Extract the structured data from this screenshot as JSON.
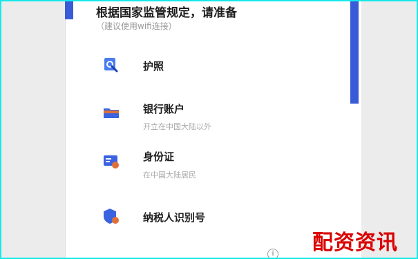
{
  "header": {
    "title": "根据国家监管规定，请准备",
    "subtitle": "（建议使用wifi连接）"
  },
  "items": [
    {
      "title": "护照",
      "subtitle": ""
    },
    {
      "title": "银行账户",
      "subtitle": "开立在中国大陆以外"
    },
    {
      "title": "身份证",
      "subtitle": "在中国大陆居民"
    },
    {
      "title": "纳税人识别号",
      "subtitle": ""
    }
  ],
  "footer_overlay": "配资资讯",
  "colors": {
    "accent": "#3a5bd8",
    "frame": "#14e8ea",
    "overlay": "#d90000"
  },
  "icons": [
    "passport-icon",
    "bank-card-icon",
    "id-card-icon",
    "tax-id-icon",
    "info-icon"
  ]
}
